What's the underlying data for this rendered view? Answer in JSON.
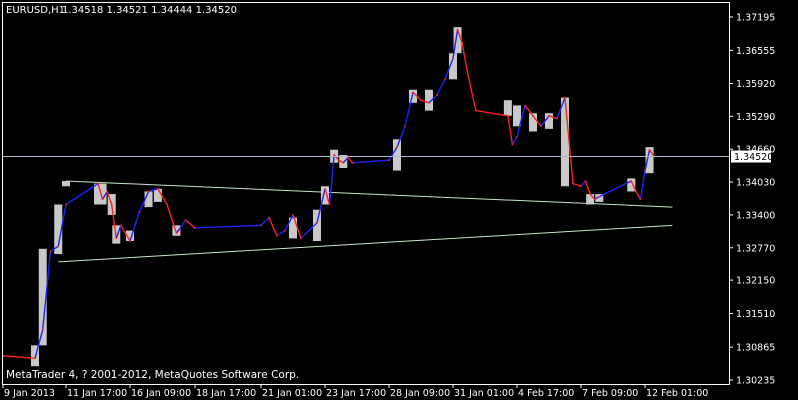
{
  "header": {
    "symbol": "EURUSD,H1",
    "ohlc": "1.34518 1.34521 1.34444 1.34520"
  },
  "footer": {
    "copyright": "MetaTrader 4, ? 2001-2012, MetaQuotes Software Corp."
  },
  "colors": {
    "background": "#000000",
    "foreground": "#ffffff",
    "bar_body": "#c8c8c8",
    "line_up": "#2020ff",
    "line_down": "#ff2020",
    "trendline": "#c8e6c8",
    "price_line": "#a8b8c8"
  },
  "chart_data": {
    "type": "line",
    "title": "EURUSD,H1",
    "price_axis": {
      "ticks": [
        "1.37195",
        "1.36555",
        "1.35920",
        "1.35290",
        "1.34660",
        "1.34030",
        "1.33400",
        "1.32770",
        "1.32150",
        "1.31510",
        "1.30865",
        "1.30235"
      ],
      "ylim": [
        1.30235,
        1.37195
      ],
      "current_price": "1.34520"
    },
    "time_axis": {
      "ticks": [
        "9 Jan 2013",
        "11 Jan 17:00",
        "16 Jan 09:00",
        "18 Jan 17:00",
        "21 Jan 01:00",
        "23 Jan 17:00",
        "28 Jan 09:00",
        "31 Jan 01:00",
        "4 Feb 17:00",
        "7 Feb 09:00",
        "12 Feb 01:00"
      ]
    },
    "price_series": [
      {
        "x": "9 Jan 2013",
        "y": 1.307
      },
      {
        "x": "10 Jan 09:00",
        "y": 1.3065
      },
      {
        "x": "10 Jan 17:00",
        "y": 1.312
      },
      {
        "x": "11 Jan 01:00",
        "y": 1.327
      },
      {
        "x": "11 Jan 09:00",
        "y": 1.328
      },
      {
        "x": "11 Jan 17:00",
        "y": 1.336
      },
      {
        "x": "14 Jan 01:00",
        "y": 1.34
      },
      {
        "x": "14 Jan 09:00",
        "y": 1.337
      },
      {
        "x": "14 Jan 17:00",
        "y": 1.3385
      },
      {
        "x": "15 Jan 01:00",
        "y": 1.336
      },
      {
        "x": "15 Jan 09:00",
        "y": 1.3295
      },
      {
        "x": "15 Jan 17:00",
        "y": 1.332
      },
      {
        "x": "16 Jan 09:00",
        "y": 1.329
      },
      {
        "x": "16 Jan 17:00",
        "y": 1.3345
      },
      {
        "x": "17 Jan 01:00",
        "y": 1.3385
      },
      {
        "x": "17 Jan 09:00",
        "y": 1.339
      },
      {
        "x": "17 Jan 17:00",
        "y": 1.336
      },
      {
        "x": "18 Jan 01:00",
        "y": 1.3305
      },
      {
        "x": "18 Jan 09:00",
        "y": 1.333
      },
      {
        "x": "18 Jan 17:00",
        "y": 1.3315
      },
      {
        "x": "21 Jan 01:00",
        "y": 1.332
      },
      {
        "x": "21 Jan 09:00",
        "y": 1.3335
      },
      {
        "x": "21 Jan 17:00",
        "y": 1.33
      },
      {
        "x": "22 Jan 01:00",
        "y": 1.331
      },
      {
        "x": "22 Jan 09:00",
        "y": 1.334
      },
      {
        "x": "22 Jan 17:00",
        "y": 1.3295
      },
      {
        "x": "23 Jan 09:00",
        "y": 1.3325
      },
      {
        "x": "23 Jan 17:00",
        "y": 1.339
      },
      {
        "x": "24 Jan 01:00",
        "y": 1.336
      },
      {
        "x": "24 Jan 09:00",
        "y": 1.3455
      },
      {
        "x": "24 Jan 17:00",
        "y": 1.3445
      },
      {
        "x": "25 Jan 01:00",
        "y": 1.344
      },
      {
        "x": "25 Jan 09:00",
        "y": 1.345
      },
      {
        "x": "25 Jan 17:00",
        "y": 1.344
      },
      {
        "x": "28 Jan 09:00",
        "y": 1.3445
      },
      {
        "x": "28 Jan 17:00",
        "y": 1.347
      },
      {
        "x": "29 Jan 01:00",
        "y": 1.351
      },
      {
        "x": "29 Jan 09:00",
        "y": 1.3575
      },
      {
        "x": "29 Jan 17:00",
        "y": 1.356
      },
      {
        "x": "30 Jan 01:00",
        "y": 1.3555
      },
      {
        "x": "30 Jan 09:00",
        "y": 1.357
      },
      {
        "x": "30 Jan 17:00",
        "y": 1.36
      },
      {
        "x": "31 Jan 01:00",
        "y": 1.364
      },
      {
        "x": "31 Jan 09:00",
        "y": 1.3695
      },
      {
        "x": "31 Jan 17:00",
        "y": 1.367
      },
      {
        "x": "1 Feb 01:00",
        "y": 1.362
      },
      {
        "x": "1 Feb 09:00",
        "y": 1.358
      },
      {
        "x": "1 Feb 17:00",
        "y": 1.354
      },
      {
        "x": "4 Feb 01:00",
        "y": 1.353
      },
      {
        "x": "4 Feb 09:00",
        "y": 1.3475
      },
      {
        "x": "4 Feb 17:00",
        "y": 1.349
      },
      {
        "x": "5 Feb 01:00",
        "y": 1.355
      },
      {
        "x": "5 Feb 09:00",
        "y": 1.353
      },
      {
        "x": "5 Feb 17:00",
        "y": 1.351
      },
      {
        "x": "6 Feb 01:00",
        "y": 1.353
      },
      {
        "x": "6 Feb 09:00",
        "y": 1.3525
      },
      {
        "x": "6 Feb 17:00",
        "y": 1.3565
      },
      {
        "x": "7 Feb 01:00",
        "y": 1.34
      },
      {
        "x": "7 Feb 09:00",
        "y": 1.3395
      },
      {
        "x": "7 Feb 17:00",
        "y": 1.3405
      },
      {
        "x": "8 Feb 01:00",
        "y": 1.338
      },
      {
        "x": "8 Feb 09:00",
        "y": 1.337
      },
      {
        "x": "8 Feb 17:00",
        "y": 1.3375
      },
      {
        "x": "11 Feb 01:00",
        "y": 1.3405
      },
      {
        "x": "11 Feb 09:00",
        "y": 1.3385
      },
      {
        "x": "11 Feb 17:00",
        "y": 1.337
      },
      {
        "x": "12 Feb 01:00",
        "y": 1.3425
      },
      {
        "x": "12 Feb 09:00",
        "y": 1.3465
      },
      {
        "x": "12 Feb 17:00",
        "y": 1.3452
      }
    ],
    "blocks": [
      {
        "x": "10 Jan 09:00",
        "low": 1.305,
        "high": 1.309
      },
      {
        "x": "10 Jan 17:00",
        "low": 1.309,
        "high": 1.3275
      },
      {
        "x": "11 Jan 09:00",
        "low": 1.3265,
        "high": 1.336
      },
      {
        "x": "11 Jan 17:00",
        "low": 1.3395,
        "high": 1.3405
      },
      {
        "x": "14 Jan 01:00",
        "low": 1.336,
        "high": 1.34
      },
      {
        "x": "14 Jan 09:00",
        "low": 1.336,
        "high": 1.34
      },
      {
        "x": "15 Jan 01:00",
        "low": 1.334,
        "high": 1.338
      },
      {
        "x": "15 Jan 09:00",
        "low": 1.3285,
        "high": 1.332
      },
      {
        "x": "16 Jan 09:00",
        "low": 1.329,
        "high": 1.331
      },
      {
        "x": "17 Jan 01:00",
        "low": 1.3355,
        "high": 1.3385
      },
      {
        "x": "17 Jan 09:00",
        "low": 1.3365,
        "high": 1.339
      },
      {
        "x": "18 Jan 01:00",
        "low": 1.33,
        "high": 1.332
      },
      {
        "x": "22 Jan 09:00",
        "low": 1.3295,
        "high": 1.3335
      },
      {
        "x": "23 Jan 09:00",
        "low": 1.329,
        "high": 1.335
      },
      {
        "x": "23 Jan 17:00",
        "low": 1.336,
        "high": 1.3395
      },
      {
        "x": "24 Jan 09:00",
        "low": 1.344,
        "high": 1.3465
      },
      {
        "x": "25 Jan 01:00",
        "low": 1.343,
        "high": 1.3455
      },
      {
        "x": "28 Jan 17:00",
        "low": 1.3425,
        "high": 1.3485
      },
      {
        "x": "29 Jan 09:00",
        "low": 1.3555,
        "high": 1.358
      },
      {
        "x": "30 Jan 01:00",
        "low": 1.354,
        "high": 1.358
      },
      {
        "x": "31 Jan 01:00",
        "low": 1.36,
        "high": 1.365
      },
      {
        "x": "31 Jan 09:00",
        "low": 1.365,
        "high": 1.37
      },
      {
        "x": "4 Feb 01:00",
        "low": 1.353,
        "high": 1.356
      },
      {
        "x": "4 Feb 17:00",
        "low": 1.351,
        "high": 1.355
      },
      {
        "x": "5 Feb 09:00",
        "low": 1.35,
        "high": 1.3535
      },
      {
        "x": "6 Feb 01:00",
        "low": 1.3505,
        "high": 1.3535
      },
      {
        "x": "6 Feb 17:00",
        "low": 1.3395,
        "high": 1.3565
      },
      {
        "x": "8 Feb 01:00",
        "low": 1.336,
        "high": 1.338
      },
      {
        "x": "8 Feb 17:00",
        "low": 1.3365,
        "high": 1.338
      },
      {
        "x": "11 Feb 01:00",
        "low": 1.3385,
        "high": 1.341
      },
      {
        "x": "12 Feb 09:00",
        "low": 1.342,
        "high": 1.347
      }
    ],
    "trendlines": [
      {
        "from": {
          "x": "11 Jan 17:00",
          "y": 1.3405
        },
        "to": {
          "x": "14 Feb 01:00",
          "y": 1.3355
        }
      },
      {
        "from": {
          "x": "11 Jan 09:00",
          "y": 1.325
        },
        "to": {
          "x": "14 Feb 01:00",
          "y": 1.332
        }
      }
    ]
  }
}
